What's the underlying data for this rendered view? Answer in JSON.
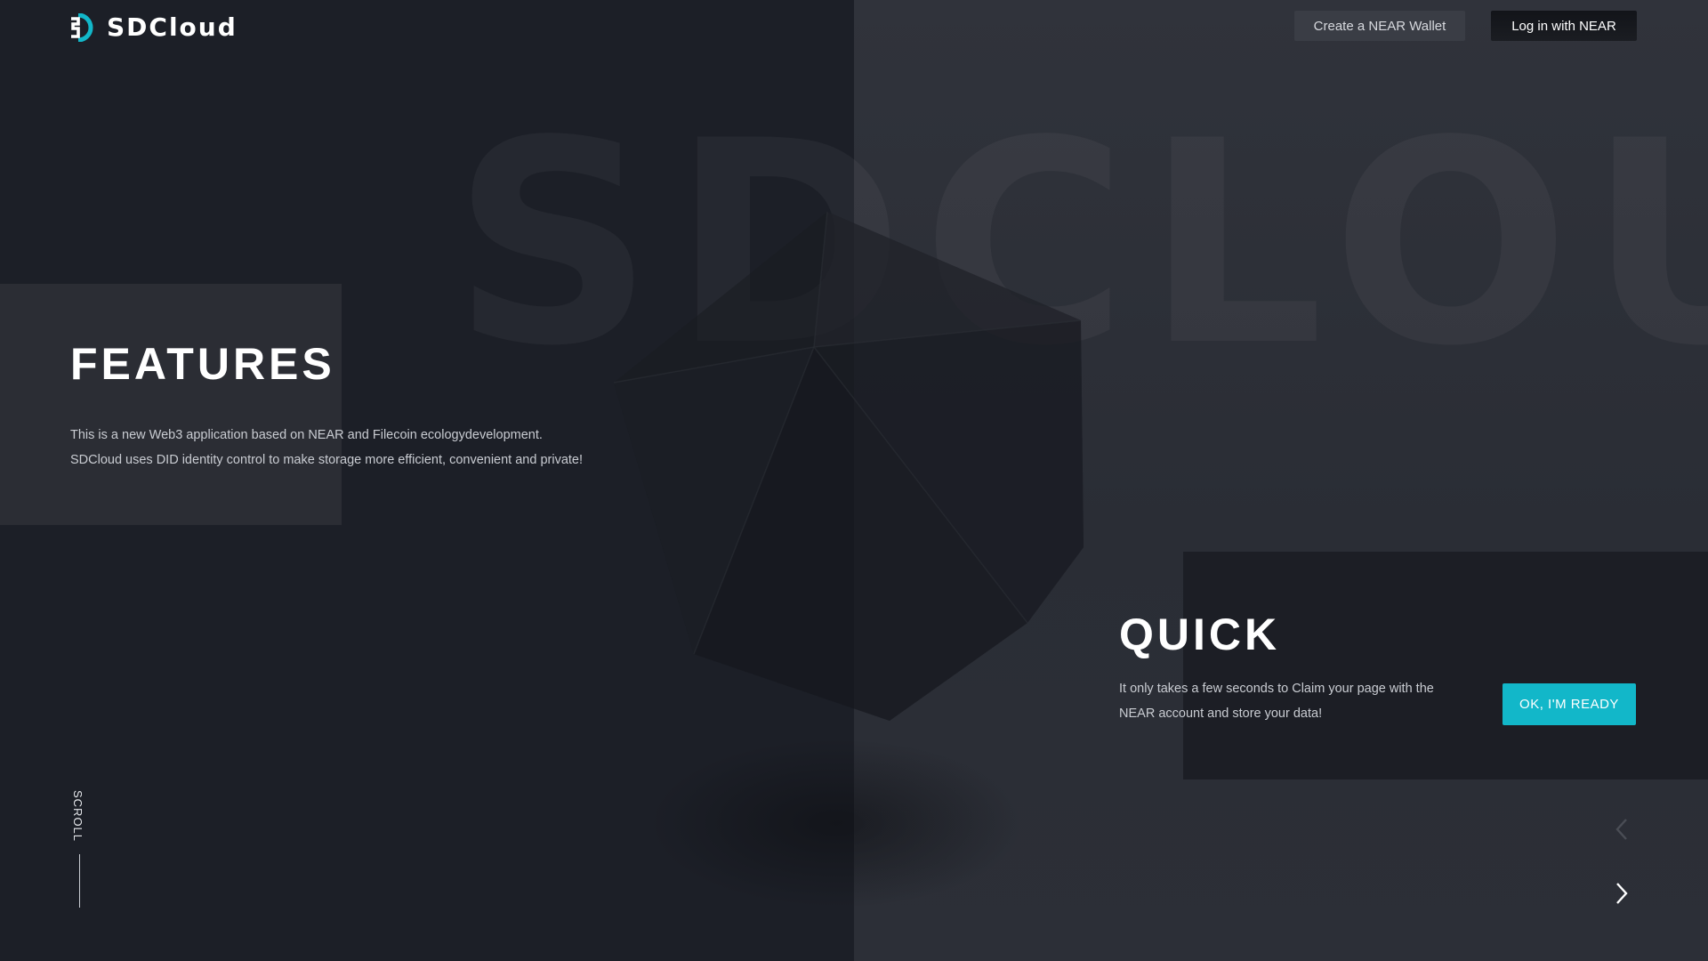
{
  "header": {
    "logo_text": "SDCloud",
    "create_wallet_label": "Create a NEAR Wallet",
    "login_label": "Log in with NEAR"
  },
  "background": {
    "watermark_text": "SDCLOUD"
  },
  "features": {
    "title": "FEATURES",
    "description": [
      "This is a new Web3 application based on NEAR and Filecoin ecologydevelopment.",
      "SDCloud uses DID identity control to make storage more efficient, convenient and private!"
    ]
  },
  "quick": {
    "title": "QUICK",
    "description": "It only takes a few seconds to Claim your page with the NEAR account and store your data!",
    "cta_label": "OK, I'M READY"
  },
  "scroll": {
    "label": "SCROLL"
  },
  "colors": {
    "accent": "#12b7c9",
    "background_dark": "#1c1f27",
    "background_light": "#2c2f37"
  },
  "icons": {
    "logo": "sdcloud-logo-icon",
    "prev": "chevron-left-icon",
    "next": "chevron-right-icon"
  }
}
